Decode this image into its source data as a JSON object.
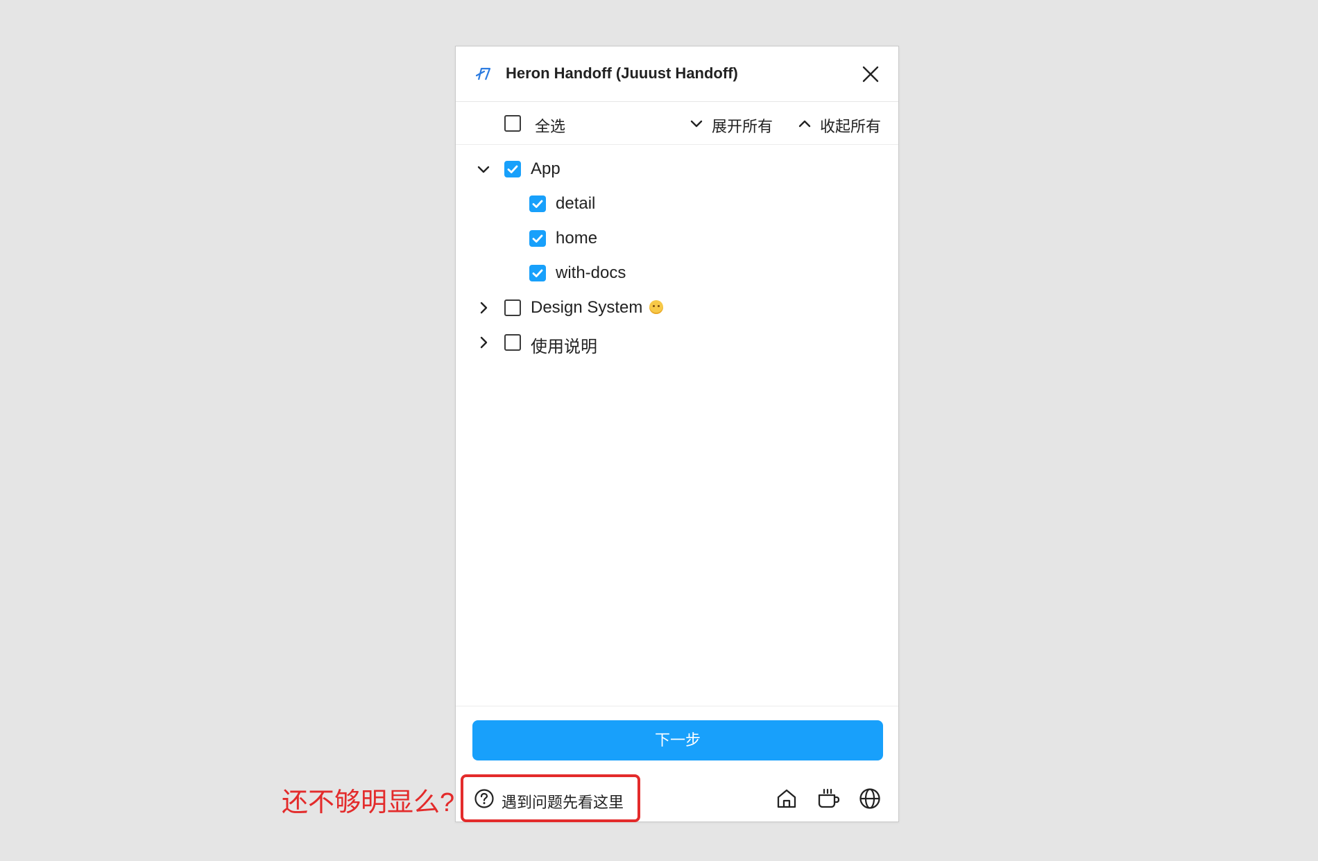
{
  "window": {
    "title": "Heron Handoff (Juuust Handoff)",
    "logo_icon": "heron-logo-icon",
    "close_icon": "close-icon"
  },
  "toolbar": {
    "select_all_label": "全选",
    "select_all_checked": false,
    "expand_all_label": "展开所有",
    "collapse_all_label": "收起所有"
  },
  "tree": [
    {
      "label": "App",
      "checked": true,
      "expanded": true,
      "children": [
        {
          "label": "detail",
          "checked": true
        },
        {
          "label": "home",
          "checked": true
        },
        {
          "label": "with-docs",
          "checked": true
        }
      ]
    },
    {
      "label": "Design System",
      "emoji": "smiley-face-emoji",
      "checked": false,
      "expanded": false
    },
    {
      "label": "使用说明",
      "checked": false,
      "expanded": false
    }
  ],
  "footer": {
    "next_button_label": "下一步",
    "help_link_label": "遇到问题先看这里",
    "icons": [
      "home-icon",
      "coffee-icon",
      "globe-icon"
    ]
  },
  "annotation": {
    "text": "还不够明显么?",
    "color": "#e32b2b"
  },
  "colors": {
    "accent": "#18a0fb",
    "background": "#e5e5e5",
    "annotation": "#e32b2b"
  }
}
